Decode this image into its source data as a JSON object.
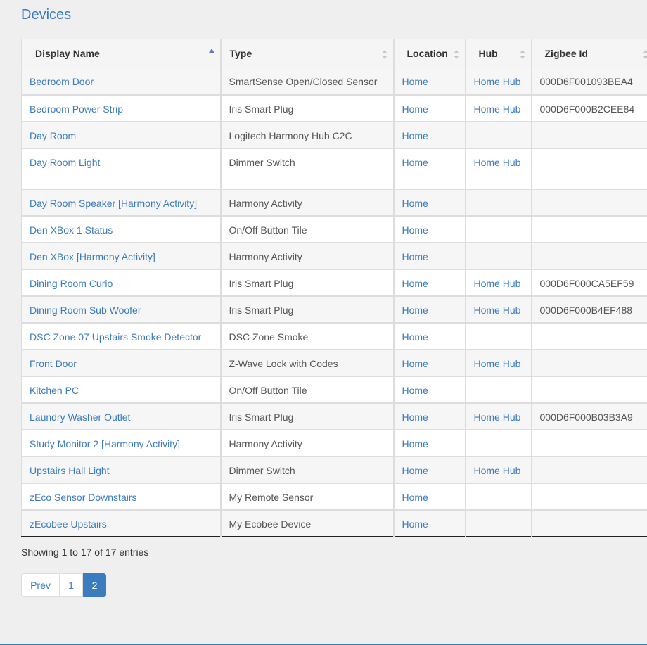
{
  "page": {
    "title": "Devices"
  },
  "table": {
    "headers": {
      "display_name": "Display Name",
      "type": "Type",
      "location": "Location",
      "hub": "Hub",
      "zigbee_id": "Zigbee Id"
    },
    "sort": {
      "column": "display_name",
      "direction": "ascending"
    },
    "rows": [
      {
        "name": "Bedroom Door",
        "type": "SmartSense Open/Closed Sensor",
        "location": "Home",
        "hub": "Home Hub",
        "zigbee": "000D6F001093BEA4"
      },
      {
        "name": "Bedroom Power Strip",
        "type": "Iris Smart Plug",
        "location": "Home",
        "hub": "Home Hub",
        "zigbee": "000D6F000B2CEE84"
      },
      {
        "name": "Day Room",
        "type": "Logitech Harmony Hub C2C",
        "location": "Home",
        "hub": "",
        "zigbee": ""
      },
      {
        "name": "Day Room Light",
        "type": "Dimmer Switch",
        "location": "Home",
        "hub": "Home Hub",
        "zigbee": ""
      },
      {
        "name": "Day Room Speaker [Harmony Activity]",
        "type": "Harmony Activity",
        "location": "Home",
        "hub": "",
        "zigbee": ""
      },
      {
        "name": "Den XBox 1 Status",
        "type": "On/Off Button Tile",
        "location": "Home",
        "hub": "",
        "zigbee": ""
      },
      {
        "name": "Den XBox [Harmony Activity]",
        "type": "Harmony Activity",
        "location": "Home",
        "hub": "",
        "zigbee": ""
      },
      {
        "name": "Dining Room Curio",
        "type": "Iris Smart Plug",
        "location": "Home",
        "hub": "Home Hub",
        "zigbee": "000D6F000CA5EF59"
      },
      {
        "name": "Dining Room Sub Woofer",
        "type": "Iris Smart Plug",
        "location": "Home",
        "hub": "Home Hub",
        "zigbee": "000D6F000B4EF488"
      },
      {
        "name": "DSC Zone 07 Upstairs Smoke Detector",
        "type": "DSC Zone Smoke",
        "location": "Home",
        "hub": "",
        "zigbee": ""
      },
      {
        "name": "Front Door",
        "type": "Z-Wave Lock with Codes",
        "location": "Home",
        "hub": "Home Hub",
        "zigbee": ""
      },
      {
        "name": "Kitchen PC",
        "type": "On/Off Button Tile",
        "location": "Home",
        "hub": "",
        "zigbee": ""
      },
      {
        "name": "Laundry Washer Outlet",
        "type": "Iris Smart Plug",
        "location": "Home",
        "hub": "Home Hub",
        "zigbee": "000D6F000B03B3A9"
      },
      {
        "name": "Study Monitor 2 [Harmony Activity]",
        "type": "Harmony Activity",
        "location": "Home",
        "hub": "",
        "zigbee": ""
      },
      {
        "name": "Upstairs Hall Light",
        "type": "Dimmer Switch",
        "location": "Home",
        "hub": "Home Hub",
        "zigbee": ""
      },
      {
        "name": "zEco Sensor Downstairs",
        "type": "My Remote Sensor",
        "location": "Home",
        "hub": "",
        "zigbee": ""
      },
      {
        "name": "zEcobee Upstairs",
        "type": "My Ecobee Device",
        "location": "Home",
        "hub": "",
        "zigbee": ""
      }
    ]
  },
  "info": {
    "text": "Showing 1 to 17 of 17 entries"
  },
  "pagination": {
    "prev": "Prev",
    "pages": [
      "1",
      "2"
    ],
    "active": "2"
  },
  "colors": {
    "link": "#3b7bbf",
    "active_page": "#3b7bbf",
    "sort_active": "#5b7fc4",
    "sort_inactive": "#c8c8c8"
  },
  "icons": {
    "sort_ascending": "sort-ascending-icon",
    "sort_both": "sort-both-icon"
  }
}
